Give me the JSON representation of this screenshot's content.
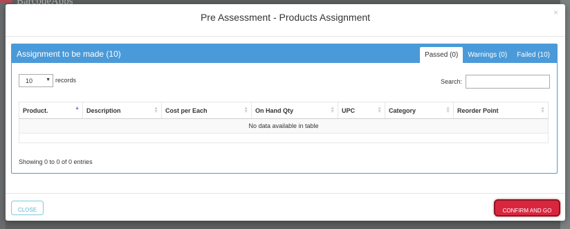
{
  "background": {
    "logo_text": "BarcodeApps"
  },
  "modal": {
    "title": "Pre Assessment - Products Assignment",
    "close_glyph": "×"
  },
  "panel": {
    "title": "Assignment to be made (10)",
    "accent_color": "#4a9ad9",
    "tabs": [
      {
        "label": "Passed (0)",
        "active": true
      },
      {
        "label": "Warnings (0)",
        "active": false
      },
      {
        "label": "Failed (10)",
        "active": false
      }
    ]
  },
  "table_controls": {
    "length_value": "10",
    "length_label": "records",
    "search_label": "Search:",
    "search_value": ""
  },
  "table": {
    "columns": [
      {
        "label": "Product.",
        "sort": "asc"
      },
      {
        "label": "Description",
        "sort": "both"
      },
      {
        "label": "Cost per Each",
        "sort": "both"
      },
      {
        "label": "On Hand Qty",
        "sort": "both"
      },
      {
        "label": "UPC",
        "sort": "both"
      },
      {
        "label": "Category",
        "sort": "both"
      },
      {
        "label": "Reorder Point",
        "sort": "both"
      }
    ],
    "empty_message": "No data available in table",
    "info": "Showing 0 to 0 of 0 entries"
  },
  "footer": {
    "close_label": "CLOSE",
    "confirm_label": "CONFIRM AND GO",
    "confirm_color": "#d9263f"
  },
  "icons": {
    "sort_asc": "sort-asc-icon",
    "sort_both": "sort-icon",
    "caret": "chevron-down-icon"
  }
}
